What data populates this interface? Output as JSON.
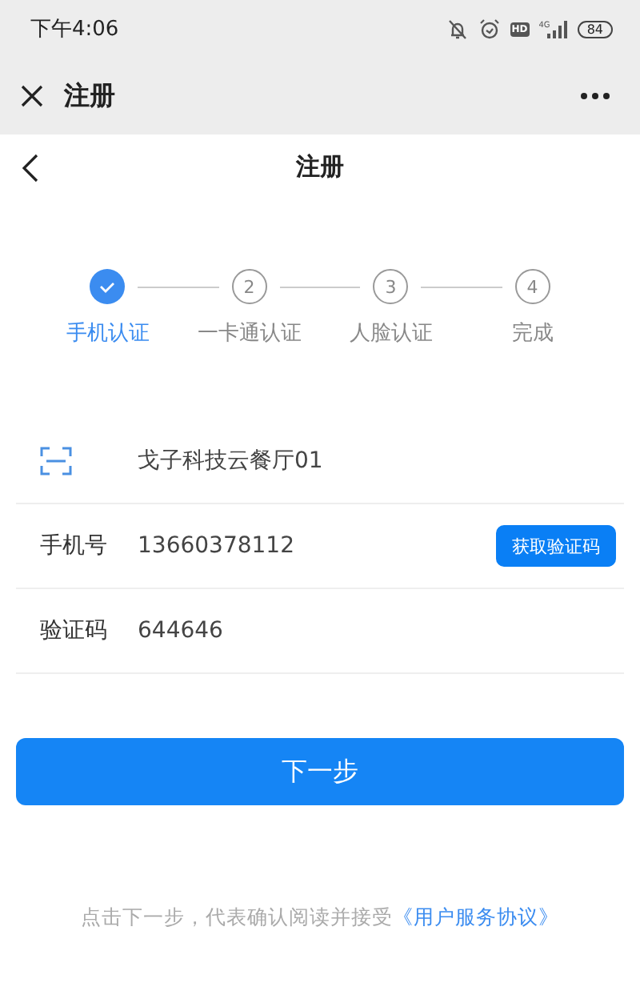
{
  "status_bar": {
    "time": "下午4:06",
    "hd": "HD",
    "network": "4G",
    "battery": "84"
  },
  "app_bar": {
    "title": "注册"
  },
  "header": {
    "title": "注册"
  },
  "steps": [
    {
      "label": "手机认证",
      "done": true
    },
    {
      "number": "2",
      "label": "一卡通认证",
      "done": false
    },
    {
      "number": "3",
      "label": "人脸认证",
      "done": false
    },
    {
      "number": "4",
      "label": "完成",
      "done": false
    }
  ],
  "form": [
    {
      "kind": "scan",
      "value": "戈子科技云餐厅01"
    },
    {
      "kind": "phone",
      "label": "手机号",
      "value": "13660378112",
      "button": "获取验证码"
    },
    {
      "kind": "text",
      "label": "验证码",
      "value": "644646"
    }
  ],
  "submit": "下一步",
  "agreement": {
    "text": "点击下一步，代表确认阅读并接受",
    "link": "《用户服务协议》"
  }
}
